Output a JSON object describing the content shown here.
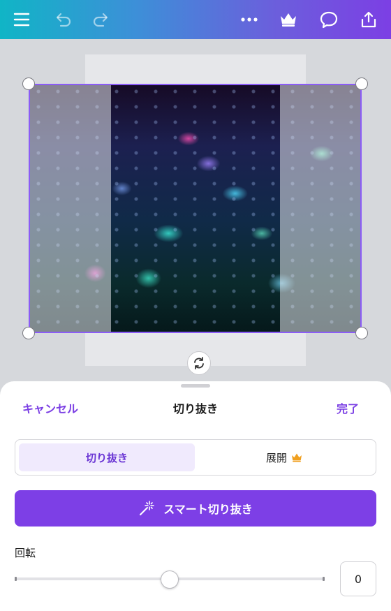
{
  "topbar": {
    "icons": [
      "menu-icon",
      "undo-icon",
      "redo-icon",
      "more-icon",
      "crown-icon",
      "comment-icon",
      "share-icon"
    ]
  },
  "crop_panel": {
    "cancel_label": "キャンセル",
    "title": "切り抜き",
    "done_label": "完了",
    "tabs": [
      {
        "label": "切り抜き",
        "active": true
      },
      {
        "label": "展開",
        "premium": true
      }
    ],
    "smart_crop_label": "スマート切り抜き",
    "rotation_label": "回転",
    "rotation_value": "0",
    "rotation_slider_fraction": 0.5
  },
  "colors": {
    "accent": "#7d3fe6",
    "topbar_gradient_start": "#10b5c6",
    "topbar_gradient_end": "#7c3fe4",
    "premium_crown": "#f0a020"
  }
}
